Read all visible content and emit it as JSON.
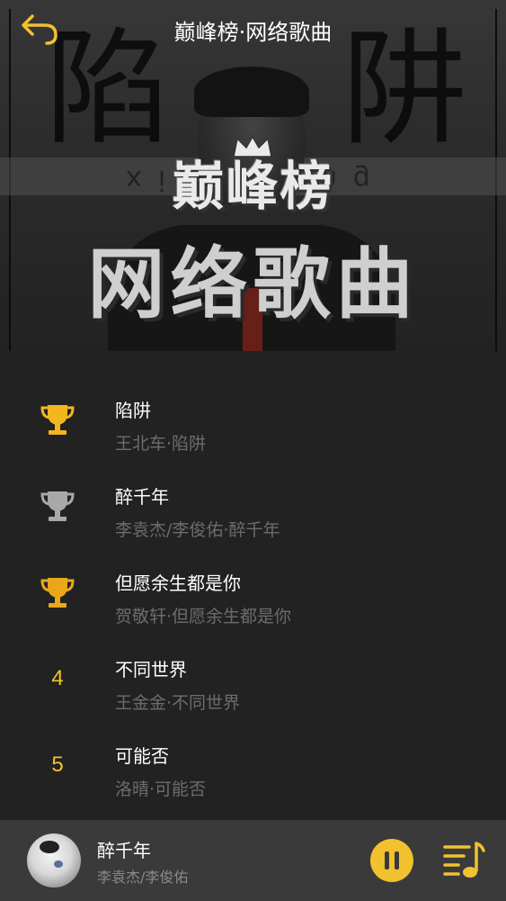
{
  "header": {
    "title": "巅峰榜·网络歌曲",
    "back_icon": "back-arrow-icon"
  },
  "cover": {
    "big_chars": [
      "陷",
      "阱"
    ],
    "pinyin": "xian jing",
    "logo_text": "巅峰榜",
    "subtitle": "网络歌曲"
  },
  "songs": [
    {
      "rank_icon": "trophy-gold-icon",
      "rank": "",
      "title": "陷阱",
      "subtitle": "王北车·陷阱"
    },
    {
      "rank_icon": "trophy-silver-icon",
      "rank": "",
      "title": "醉千年",
      "subtitle": "李袁杰/李俊佑·醉千年"
    },
    {
      "rank_icon": "trophy-bronze-icon",
      "rank": "",
      "title": "但愿余生都是你",
      "subtitle": "贺敬轩·但愿余生都是你"
    },
    {
      "rank_icon": "",
      "rank": "4",
      "title": "不同世界",
      "subtitle": "王金金·不同世界"
    },
    {
      "rank_icon": "",
      "rank": "5",
      "title": "可能否",
      "subtitle": "洛晴·可能否"
    }
  ],
  "player": {
    "title": "醉千年",
    "artist": "李袁杰/李俊佑",
    "play_icon": "pause-icon",
    "playlist_icon": "playlist-icon"
  },
  "colors": {
    "accent": "#f2c12e",
    "background": "#222222",
    "player_bar": "#3a3a3a",
    "trophy_gold": "#f2b61e",
    "trophy_silver": "#a8a8a8",
    "trophy_bronze": "#e8a81a"
  }
}
